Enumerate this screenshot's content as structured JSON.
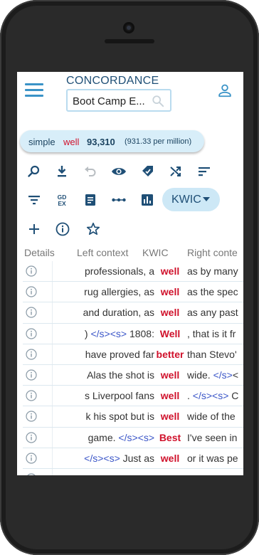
{
  "header": {
    "title": "CONCORDANCE",
    "search_value": "Boot Camp E..."
  },
  "query_chip": {
    "type": "simple",
    "term": "well",
    "count": "93,310",
    "per_million": "(931.33 per million)"
  },
  "toolbar": {
    "view_button_label": "KWIC"
  },
  "table": {
    "columns": {
      "details": "Details",
      "left": "Left context",
      "kwic": "KWIC",
      "right": "Right conte"
    },
    "rows": [
      {
        "left": "professionals, a",
        "kwic": "well",
        "right": "as by many"
      },
      {
        "left": "rug allergies, as",
        "kwic": "well",
        "right": "as the spec"
      },
      {
        "left": "and duration, as",
        "kwic": "well",
        "right": "as any past"
      },
      {
        "left": ") </s><s> 1808:",
        "kwic": "Well",
        "right": ", that is it fr"
      },
      {
        "left": "have proved far",
        "kwic": "better",
        "right": "than Stevo'"
      },
      {
        "left": "Alas the shot is",
        "kwic": "well",
        "right": "wide. </s><"
      },
      {
        "left": "s Liverpool fans",
        "kwic": "well",
        "right": ". </s><s> C"
      },
      {
        "left": "k his spot but is",
        "kwic": "well",
        "right": "wide of the"
      },
      {
        "left": "game. </s><s>",
        "kwic": "Best",
        "right": "I've seen in"
      },
      {
        "left": "</s><s> Just as",
        "kwic": "well",
        "right": "or it was pe"
      },
      {
        "left": "",
        "kwic": "",
        "right": ""
      }
    ]
  },
  "colors": {
    "accent": "#3a93c7",
    "keyword": "#d0112b",
    "chip_bg": "#d8eef9"
  }
}
